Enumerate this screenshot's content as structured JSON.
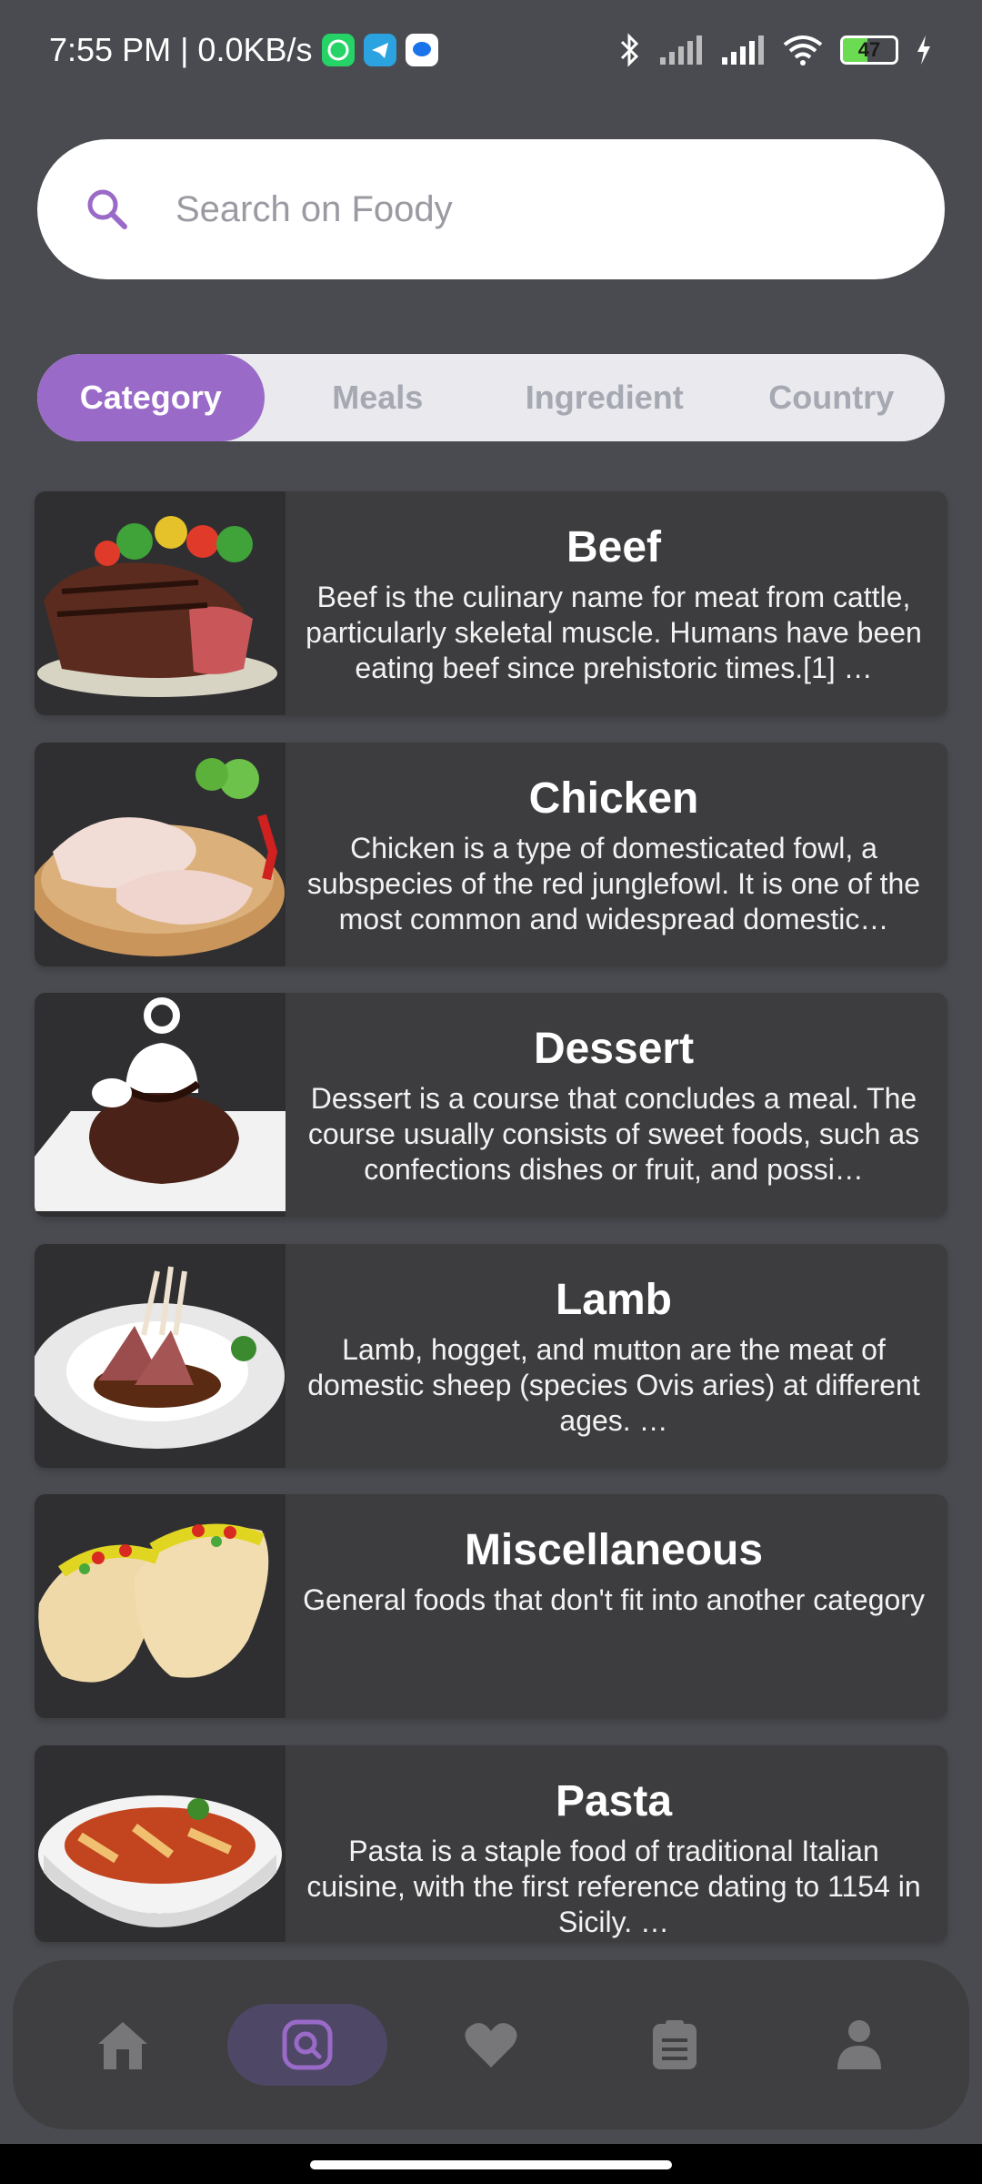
{
  "status_bar": {
    "time_speed": "7:55 PM | 0.0KB/s",
    "battery_level": "47",
    "battery_fraction": 0.47
  },
  "search": {
    "placeholder": "Search on Foody",
    "value": ""
  },
  "tabs": [
    {
      "label": "Category",
      "active": true
    },
    {
      "label": "Meals",
      "active": false
    },
    {
      "label": "Ingredient",
      "active": false
    },
    {
      "label": "Country",
      "active": false
    }
  ],
  "categories": [
    {
      "title": "Beef",
      "description": "Beef is the culinary name for meat from cattle, particularly skeletal muscle. Humans have been eating beef since prehistoric times.[1] …"
    },
    {
      "title": "Chicken",
      "description": "Chicken is a type of domesticated fowl, a subspecies of the red junglefowl. It is one of the most common and widespread domestic…"
    },
    {
      "title": "Dessert",
      "description": "Dessert is a course that concludes a meal. The course usually consists of sweet foods, such as confections dishes or fruit, and possi…"
    },
    {
      "title": "Lamb",
      "description": "Lamb, hogget, and mutton are the meat of domestic sheep (species Ovis aries) at different ages. …"
    },
    {
      "title": "Miscellaneous",
      "description": "General foods that don't fit into another category"
    },
    {
      "title": "Pasta",
      "description": "Pasta is a staple food of traditional Italian cuisine, with the first reference dating to 1154 in Sicily. …"
    }
  ],
  "bottom_nav": [
    {
      "icon": "home-icon",
      "active": false
    },
    {
      "icon": "search-icon",
      "active": true
    },
    {
      "icon": "heart-icon",
      "active": false
    },
    {
      "icon": "list-icon",
      "active": false
    },
    {
      "icon": "profile-icon",
      "active": false
    }
  ],
  "colors": {
    "accent": "#9a6ac8",
    "background": "#4a4b50",
    "card": "#3d3d3f"
  }
}
